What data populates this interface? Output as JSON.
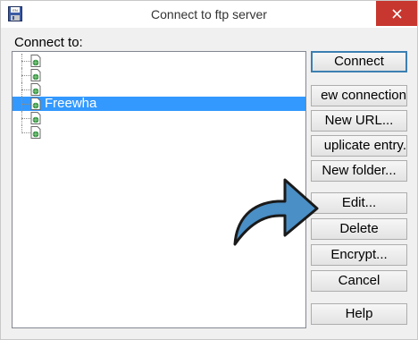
{
  "window": {
    "title": "Connect to ftp server"
  },
  "connect_label": "Connect to:",
  "tree": {
    "items": [
      {
        "label": "",
        "selected": false
      },
      {
        "label": "",
        "selected": false
      },
      {
        "label": "",
        "selected": false
      },
      {
        "label": "Freewha",
        "selected": true
      },
      {
        "label": "",
        "selected": false
      },
      {
        "label": "",
        "selected": false
      }
    ]
  },
  "buttons": {
    "connect": "Connect",
    "new_connection": "ew connection",
    "new_url": "New URL...",
    "duplicate_entry": "uplicate entry.",
    "new_folder": "New folder...",
    "edit": "Edit...",
    "delete": "Delete",
    "encrypt": "Encrypt...",
    "cancel": "Cancel",
    "help": "Help"
  },
  "colors": {
    "close_button": "#c7372f",
    "selection": "#3399ff",
    "arrow_fill": "#4a8fc6"
  },
  "icons": {
    "app": "floppy-disk-icon",
    "close": "close-icon",
    "node": "page-globe-icon",
    "annotation": "curved-arrow-icon"
  }
}
